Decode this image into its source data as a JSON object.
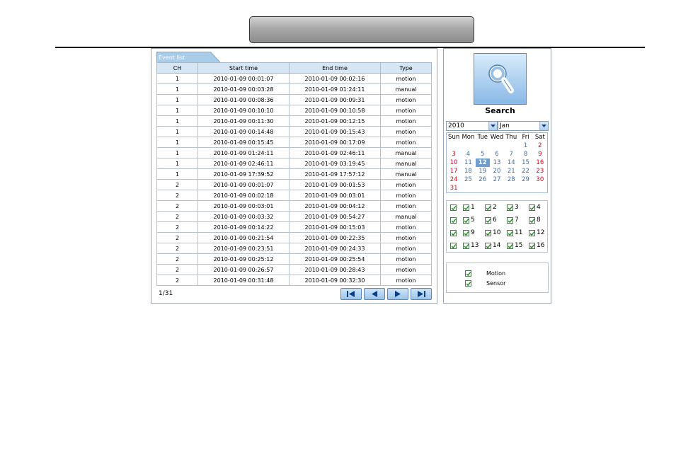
{
  "header": {
    "title": ""
  },
  "event_list": {
    "tab_label": "Event list",
    "columns": [
      "CH",
      "Start time",
      "End time",
      "Type"
    ],
    "rows": [
      [
        "1",
        "2010-01-09 00:01:07",
        "2010-01-09 00:02:16",
        "motion"
      ],
      [
        "1",
        "2010-01-09 00:03:28",
        "2010-01-09 01:24:11",
        "manual"
      ],
      [
        "1",
        "2010-01-09 00:08:36",
        "2010-01-09 00:09:31",
        "motion"
      ],
      [
        "1",
        "2010-01-09 00:10:10",
        "2010-01-09 00:10:58",
        "motion"
      ],
      [
        "1",
        "2010-01-09 00:11:30",
        "2010-01-09 00:12:15",
        "motion"
      ],
      [
        "1",
        "2010-01-09 00:14:48",
        "2010-01-09 00:15:43",
        "motion"
      ],
      [
        "1",
        "2010-01-09 00:15:45",
        "2010-01-09 00:17:09",
        "motion"
      ],
      [
        "1",
        "2010-01-09 01:24:11",
        "2010-01-09 02:46:11",
        "manual"
      ],
      [
        "1",
        "2010-01-09 02:46:11",
        "2010-01-09 03:19:45",
        "manual"
      ],
      [
        "1",
        "2010-01-09 17:39:52",
        "2010-01-09 17:57:12",
        "manual"
      ],
      [
        "2",
        "2010-01-09 00:01:07",
        "2010-01-09 00:01:53",
        "motion"
      ],
      [
        "2",
        "2010-01-09 00:02:18",
        "2010-01-09 00:03:01",
        "motion"
      ],
      [
        "2",
        "2010-01-09 00:03:01",
        "2010-01-09 00:04:12",
        "motion"
      ],
      [
        "2",
        "2010-01-09 00:03:32",
        "2010-01-09 00:54:27",
        "manual"
      ],
      [
        "2",
        "2010-01-09 00:14:22",
        "2010-01-09 00:15:03",
        "motion"
      ],
      [
        "2",
        "2010-01-09 00:21:54",
        "2010-01-09 00:22:35",
        "motion"
      ],
      [
        "2",
        "2010-01-09 00:23:51",
        "2010-01-09 00:24:33",
        "motion"
      ],
      [
        "2",
        "2010-01-09 00:25:12",
        "2010-01-09 00:25:54",
        "motion"
      ],
      [
        "2",
        "2010-01-09 00:26:57",
        "2010-01-09 00:28:43",
        "motion"
      ],
      [
        "2",
        "2010-01-09 00:31:48",
        "2010-01-09 00:32:30",
        "motion"
      ]
    ],
    "page_indicator": "1/31",
    "nav_icons": [
      "first-page-icon",
      "prev-page-icon",
      "next-page-icon",
      "last-page-icon"
    ]
  },
  "search": {
    "label": "Search",
    "icon": "magnifier-icon"
  },
  "calendar": {
    "year": "2010",
    "month": "Jan",
    "weekdays": [
      "Sun",
      "Mon",
      "Tue",
      "Wed",
      "Thu",
      "Fri",
      "Sat"
    ],
    "weeks": [
      [
        "",
        "",
        "",
        "",
        "",
        "1",
        "2"
      ],
      [
        "3",
        "4",
        "5",
        "6",
        "7",
        "8",
        "9"
      ],
      [
        "10",
        "11",
        "12",
        "13",
        "14",
        "15",
        "16"
      ],
      [
        "17",
        "18",
        "19",
        "20",
        "21",
        "22",
        "23"
      ],
      [
        "24",
        "25",
        "26",
        "27",
        "28",
        "29",
        "30"
      ],
      [
        "31",
        "",
        "",
        "",
        "",
        "",
        ""
      ]
    ],
    "selected_day": "12",
    "weekend_color": "#d0021b",
    "weekday_color": "#406c9e",
    "selected_color": "#6f9dd1"
  },
  "channels": {
    "rows": [
      [
        "1",
        "2",
        "3",
        "4"
      ],
      [
        "5",
        "6",
        "7",
        "8"
      ],
      [
        "9",
        "10",
        "11",
        "12"
      ],
      [
        "13",
        "14",
        "15",
        "16"
      ]
    ],
    "all_checked": true
  },
  "event_types": [
    {
      "label": "Motion",
      "checked": true
    },
    {
      "label": "Sensor",
      "checked": true
    }
  ],
  "colors": {
    "header_bg": "#d6e6f5",
    "tab_bg": "#a9cde9",
    "button_bg": "#9cc5ea"
  }
}
